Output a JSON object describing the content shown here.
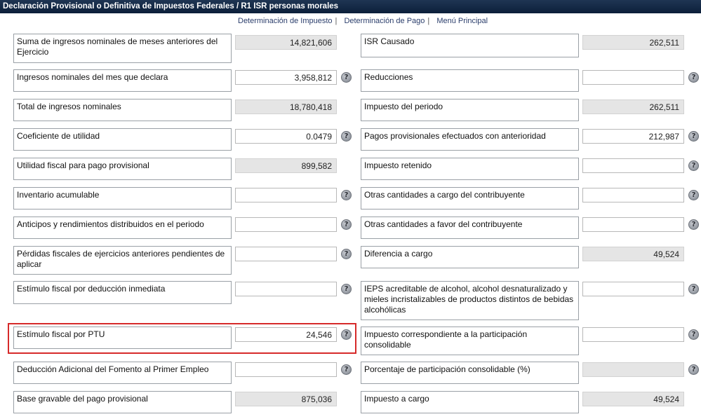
{
  "title": "Declaración Provisional o Definitiva de Impuestos Federales / R1 ISR personas morales",
  "nav": [
    "Determinación de Impuesto",
    "Determinación de Pago",
    "Menú Principal"
  ],
  "help_glyph": "?",
  "left_rows": [
    {
      "label": "Suma de ingresos nominales de meses anteriores del Ejercicio",
      "value": "14,821,606",
      "readonly": true
    },
    {
      "label": "Ingresos nominales del mes que declara",
      "value": "3,958,812",
      "readonly": false
    },
    {
      "label": "Total de ingresos nominales",
      "value": "18,780,418",
      "readonly": true
    },
    {
      "label": "Coeficiente de utilidad",
      "value": "0.0479",
      "readonly": false
    },
    {
      "label": "Utilidad fiscal para pago provisional",
      "value": "899,582",
      "readonly": true
    },
    {
      "label": "Inventario acumulable",
      "value": "",
      "readonly": false
    },
    {
      "label": "Anticipos y rendimientos distribuidos en el periodo",
      "value": "",
      "readonly": false
    },
    {
      "label": "Pérdidas fiscales de ejercicios anteriores pendientes de aplicar",
      "value": "",
      "readonly": false
    },
    {
      "label": "Estímulo fiscal por deducción inmediata",
      "value": "",
      "readonly": false
    },
    {
      "label": "Estímulo fiscal por PTU",
      "value": "24,546",
      "readonly": false
    },
    {
      "label": "Deducción Adicional del Fomento al Primer Empleo",
      "value": "",
      "readonly": false
    },
    {
      "label": "Base gravable del pago provisional",
      "value": "875,036",
      "readonly": true
    }
  ],
  "right_rows": [
    {
      "label": "ISR Causado",
      "value": "262,511",
      "readonly": true
    },
    {
      "label": "Reducciones",
      "value": "",
      "readonly": false
    },
    {
      "label": "Impuesto del periodo",
      "value": "262,511",
      "readonly": true
    },
    {
      "label": "Pagos provisionales efectuados con anterioridad",
      "value": "212,987",
      "readonly": false
    },
    {
      "label": "Impuesto retenido",
      "value": "",
      "readonly": false
    },
    {
      "label": "Otras cantidades a cargo del contribuyente",
      "value": "",
      "readonly": false
    },
    {
      "label": "Otras cantidades a favor del contribuyente",
      "value": "",
      "readonly": false
    },
    {
      "label": "Diferencia a cargo",
      "value": "49,524",
      "readonly": true
    },
    {
      "label": "IEPS acreditable de alcohol, alcohol desnaturalizado y mieles incristalizables de productos distintos de bebidas alcohólicas",
      "value": "",
      "readonly": false
    },
    {
      "label": "Impuesto correspondiente a la participación consolidable",
      "value": "",
      "readonly": false
    },
    {
      "label": "Porcentaje de participación consolidable (%)",
      "value": "",
      "readonly": true
    },
    {
      "label": "Impuesto a cargo",
      "value": "49,524",
      "readonly": true
    }
  ]
}
